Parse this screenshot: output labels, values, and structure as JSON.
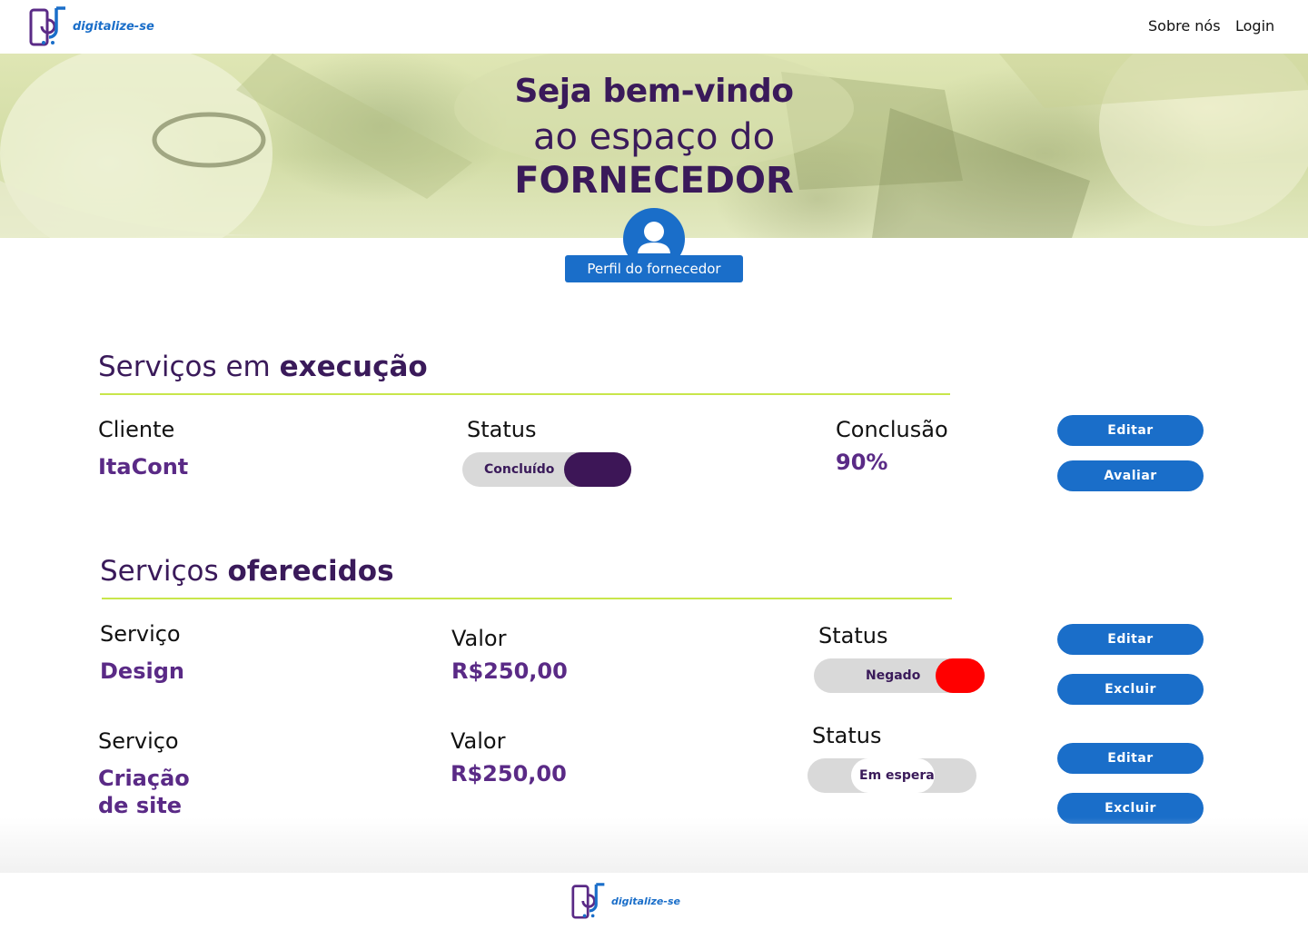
{
  "brand": {
    "name": "digitalize-se",
    "color": "#1a6ec9",
    "accent": "#3a1a5a"
  },
  "nav": {
    "about": "Sobre nós",
    "login": "Login"
  },
  "hero": {
    "line1": "Seja bem-vindo",
    "line2": "ao espaço do",
    "line3": "FORNECEDOR",
    "profile_button": "Perfil do fornecedor"
  },
  "execution": {
    "title_light": "Serviços em ",
    "title_bold": "execução",
    "client_label": "Cliente",
    "client_value": "ItaCont",
    "status_label": "Status",
    "status_value": "Concluído",
    "conclusion_label": "Conclusão",
    "conclusion_value": "90%",
    "edit_button": "Editar",
    "rate_button": "Avaliar"
  },
  "offered": {
    "title_light": "Serviços ",
    "title_bold": "oferecidos",
    "items": [
      {
        "service_label": "Serviço",
        "service_value": "Design",
        "value_label": "Valor",
        "value_value": "R$250,00",
        "status_label": "Status",
        "status_value": "Negado",
        "status_color": "#ff0000",
        "edit_button": "Editar",
        "delete_button": "Excluir"
      },
      {
        "service_label": "Serviço",
        "service_value_line1": "Criação",
        "service_value_line2": "de site",
        "value_label": "Valor",
        "value_value": "R$250,00",
        "status_label": "Status",
        "status_value": "Em espera",
        "status_color": "#ffffff",
        "edit_button": "Editar",
        "delete_button": "Excluir"
      }
    ]
  },
  "footer": {
    "brand": "digitalize-se"
  }
}
